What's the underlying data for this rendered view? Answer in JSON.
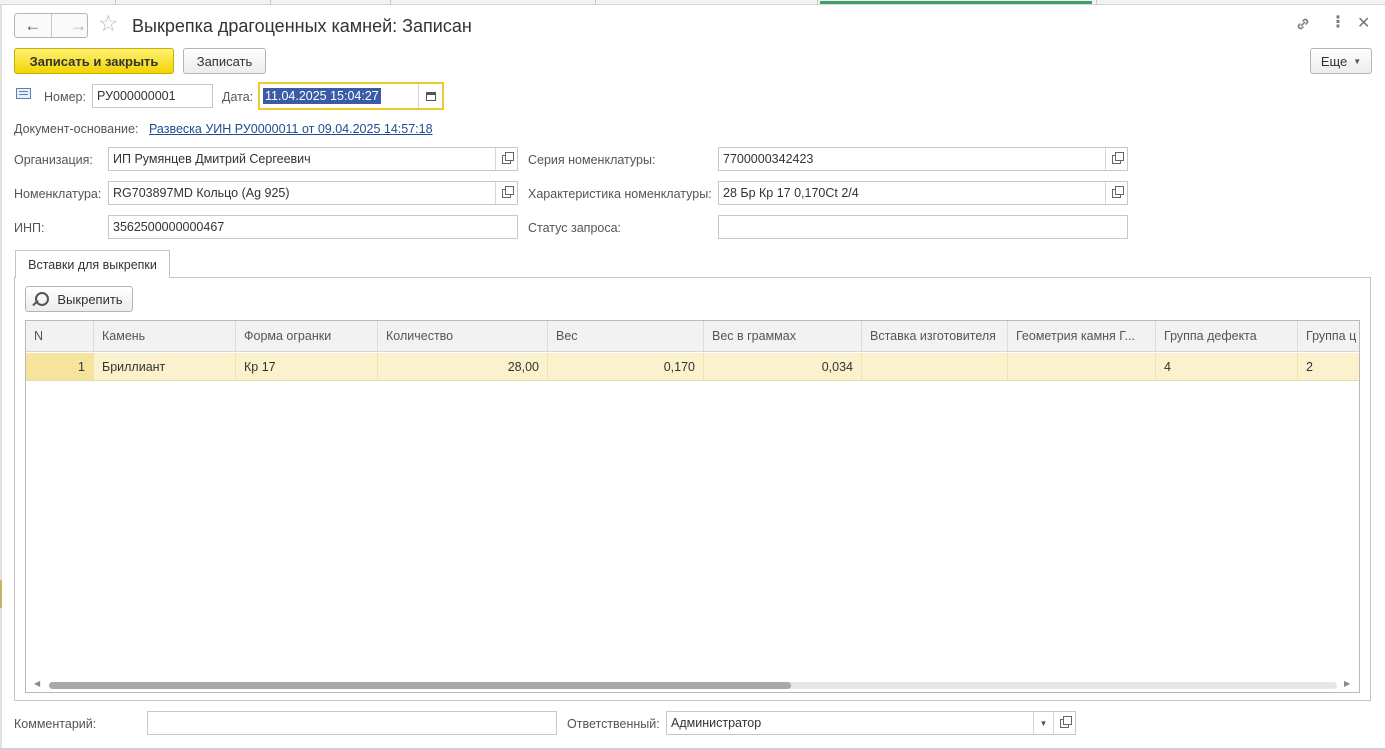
{
  "window": {
    "title": "Выкрепка драгоценных камней: Записан"
  },
  "toolbar": {
    "save_close_label": "Записать и закрыть",
    "save_label": "Записать",
    "more_label": "Еще"
  },
  "header": {
    "number_label": "Номер:",
    "number_value": "РУ000000001",
    "date_label": "Дата:",
    "date_value": "11.04.2025 15:04:27",
    "basis_label": "Документ-основание:",
    "basis_link": "Развеска УИН РУ0000011 от 09.04.2025 14:57:18"
  },
  "form": {
    "org_label": "Организация:",
    "org_value": "ИП Румянцев Дмитрий Сергеевич",
    "nom_label": "Номенклатура:",
    "nom_value": "RG703897MD Кольцо (Ag 925)",
    "inp_label": "ИНП:",
    "inp_value": "3562500000000467",
    "series_label": "Серия номенклатуры:",
    "series_value": "7700000342423",
    "char_label": "Характеристика номенклатуры:",
    "char_value": "28 Бр Кр 17 0,170Ct 2/4",
    "status_label": "Статус запроса:",
    "status_value": ""
  },
  "tabs": [
    {
      "label": "Вставки для выкрепки"
    }
  ],
  "panel": {
    "unpin_label": "Выкрепить"
  },
  "table": {
    "columns": [
      "N",
      "Камень",
      "Форма огранки",
      "Количество",
      "Вес",
      "Вес в граммах",
      "Вставка изготовителя",
      "Геометрия камня Г...",
      "Группа дефекта",
      "Группа ц"
    ],
    "rows": [
      [
        "1",
        "Бриллиант",
        "Кр 17",
        "28,00",
        "0,170",
        "0,034",
        "",
        "",
        "4",
        "2"
      ]
    ]
  },
  "footer": {
    "comment_label": "Комментарий:",
    "comment_value": "",
    "responsible_label": "Ответственный:",
    "responsible_value": "Администратор"
  },
  "icons": {
    "back": "arrow-left-icon",
    "forward": "arrow-right-icon",
    "favorite": "star-icon",
    "link": "link-icon",
    "menu": "more-vertical-icon",
    "close": "close-icon",
    "calendar": "calendar-icon",
    "open": "open-form-icon"
  },
  "colors": {
    "primary_button": "#f1d500",
    "selected_row": "#fbf2cd",
    "link": "#1e4d8f",
    "focus_border": "#f0c92c"
  }
}
